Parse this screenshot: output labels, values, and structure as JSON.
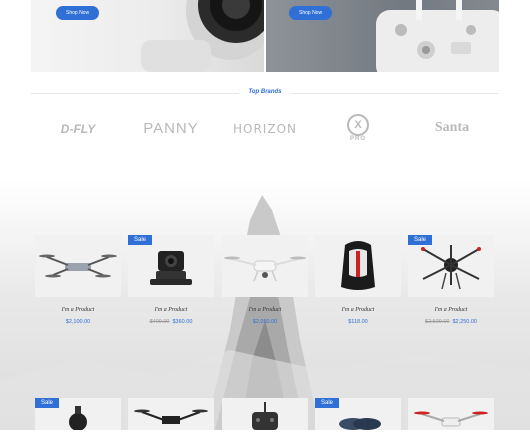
{
  "hero": {
    "left_button": "Shop Now",
    "right_button": "Shop Now"
  },
  "brands": {
    "title": "Top Brands",
    "items": [
      {
        "name": "D-FLY"
      },
      {
        "name": "PANNY"
      },
      {
        "name": "HORIZON"
      },
      {
        "name": "PRO",
        "mark": "X"
      },
      {
        "name": "Santa"
      }
    ]
  },
  "products_row1": [
    {
      "name": "I'm a Product",
      "price": "$2,100.00",
      "old_price": "",
      "sale": ""
    },
    {
      "name": "I'm a Product",
      "price": "$360.00",
      "old_price": "$400.00",
      "sale": "Sale"
    },
    {
      "name": "I'm a Product",
      "price": "$2,050.00",
      "old_price": "",
      "sale": ""
    },
    {
      "name": "I'm a Product",
      "price": "$118.00",
      "old_price": "",
      "sale": ""
    },
    {
      "name": "I'm a Product",
      "price": "$2,250.00",
      "old_price": "$2,500.00",
      "sale": "Sale"
    }
  ],
  "products_row2": [
    {
      "sale": "Sale"
    },
    {
      "sale": ""
    },
    {
      "sale": ""
    },
    {
      "sale": "Sale"
    },
    {
      "sale": ""
    }
  ],
  "colors": {
    "accent": "#2f6fd6",
    "brand_gray": "#b9b9b9"
  }
}
